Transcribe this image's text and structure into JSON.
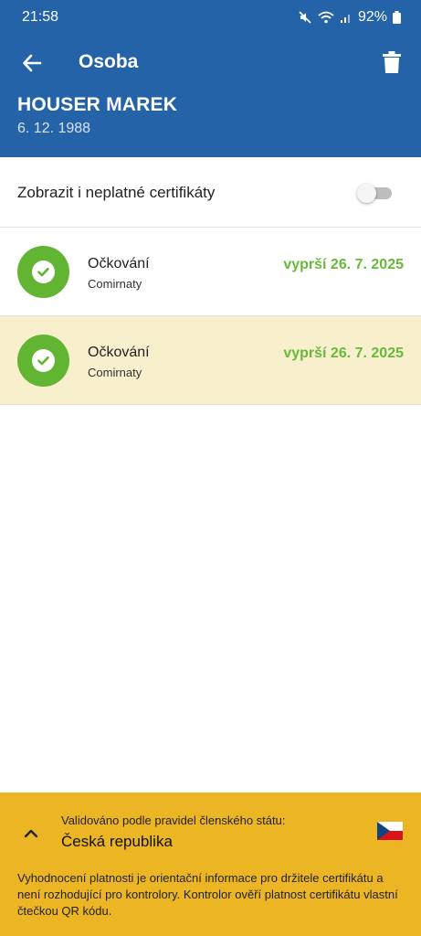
{
  "status_bar": {
    "time": "21:58",
    "battery": "92%"
  },
  "toolbar": {
    "title": "Osoba"
  },
  "person": {
    "name": "HOUSER MAREK",
    "dob": "6. 12. 1988"
  },
  "filter": {
    "label": "Zobrazit i neplatné certifikáty",
    "enabled": false
  },
  "certificates": [
    {
      "title": "Očkování",
      "subtitle": "Comirnaty",
      "expiry": "vyprší 26. 7. 2025",
      "status": "valid",
      "highlighted": false
    },
    {
      "title": "Očkování",
      "subtitle": "Comirnaty",
      "expiry": "vyprší 26. 7. 2025",
      "status": "valid",
      "highlighted": true
    }
  ],
  "footer": {
    "rule_label": "Validováno podle pravidel členského státu:",
    "country": "Česká republika",
    "note": "Vyhodnocení platnosti je orientační informace pro držitele certifikátu a není rozhodující pro kontrolory. Kontrolor ověří platnost certifikátu vlastní čtečkou QR kódu."
  },
  "colors": {
    "header": "#2563a8",
    "valid_green": "#62b532",
    "expiry_text": "#68b93a",
    "highlight_row": "#f8efcd",
    "footer_bg": "#ebb524"
  },
  "icons": {
    "back": "arrow-left-icon",
    "delete": "trash-icon",
    "check": "check-icon",
    "chevron": "chevron-up-icon",
    "flag": "czech-flag-icon"
  }
}
